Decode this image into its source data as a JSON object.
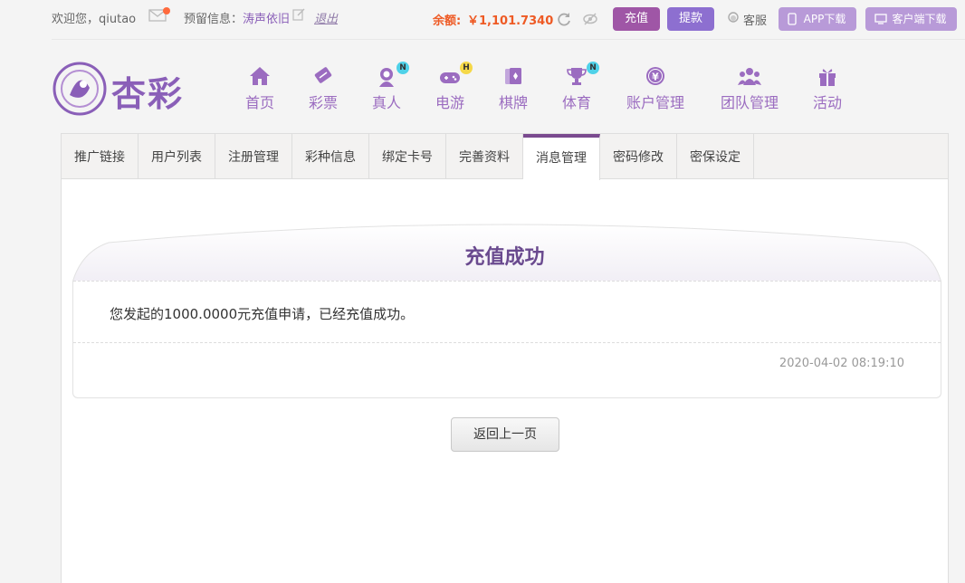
{
  "topbar": {
    "welcome": "欢迎您，qiutao",
    "reserved_label": "预留信息：",
    "reserved_value": "涛声依旧",
    "logout": "退出",
    "balance_label": "余额:",
    "balance_value": "￥1,101.7340",
    "recharge": "充值",
    "withdraw": "提款",
    "service": "客服",
    "app_download": "APP下载",
    "client_download": "客户端下载"
  },
  "logo": {
    "text": "杏彩"
  },
  "nav": {
    "items": [
      {
        "label": "首页",
        "icon": "home-icon"
      },
      {
        "label": "彩票",
        "icon": "lottery-ticket-icon"
      },
      {
        "label": "真人",
        "icon": "live-dealer-icon",
        "badge": "N"
      },
      {
        "label": "电游",
        "icon": "gamepad-icon",
        "badge": "H"
      },
      {
        "label": "棋牌",
        "icon": "cards-icon"
      },
      {
        "label": "体育",
        "icon": "trophy-icon",
        "badge": "N"
      },
      {
        "label": "账户管理",
        "icon": "yen-coin-icon"
      },
      {
        "label": "团队管理",
        "icon": "team-icon"
      },
      {
        "label": "活动",
        "icon": "gift-icon"
      }
    ]
  },
  "tabs": [
    {
      "label": "推广链接"
    },
    {
      "label": "用户列表"
    },
    {
      "label": "注册管理"
    },
    {
      "label": "彩种信息"
    },
    {
      "label": "绑定卡号"
    },
    {
      "label": "完善资料"
    },
    {
      "label": "消息管理",
      "active": true
    },
    {
      "label": "密码修改"
    },
    {
      "label": "密保设定"
    }
  ],
  "message": {
    "title": "充值成功",
    "body": "您发起的1000.0000元充值申请，已经充值成功。",
    "time": "2020-04-02 08:19:10"
  },
  "back_button": "返回上一页",
  "colors": {
    "accent": "#8a5fb8",
    "recharge": "#9f56a6",
    "withdraw": "#8d6fd0",
    "balance": "#ee5a24"
  }
}
